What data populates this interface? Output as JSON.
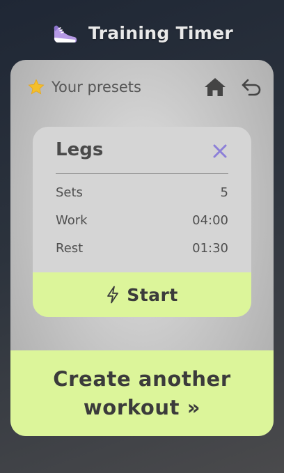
{
  "app": {
    "title": "Training Timer",
    "logo_icon": "sneaker-icon"
  },
  "presets_panel": {
    "title": "Your presets",
    "title_icon": "star-icon",
    "nav": {
      "home_icon": "home-icon",
      "back_icon": "return-arrow-icon"
    }
  },
  "preset_card": {
    "name": "Legs",
    "close_icon": "close-icon",
    "rows": [
      {
        "label": "Sets",
        "value": "5"
      },
      {
        "label": "Work",
        "value": "04:00"
      },
      {
        "label": "Rest",
        "value": "01:30"
      }
    ],
    "start_label": "Start",
    "start_icon": "lightning-icon"
  },
  "create_button": {
    "label": "Create another workout »"
  },
  "colors": {
    "accent_green": "#dcf59a",
    "close_purple": "#8c7fd8",
    "star_yellow": "#f4bf2a",
    "text_dark": "#3b3b3b"
  }
}
